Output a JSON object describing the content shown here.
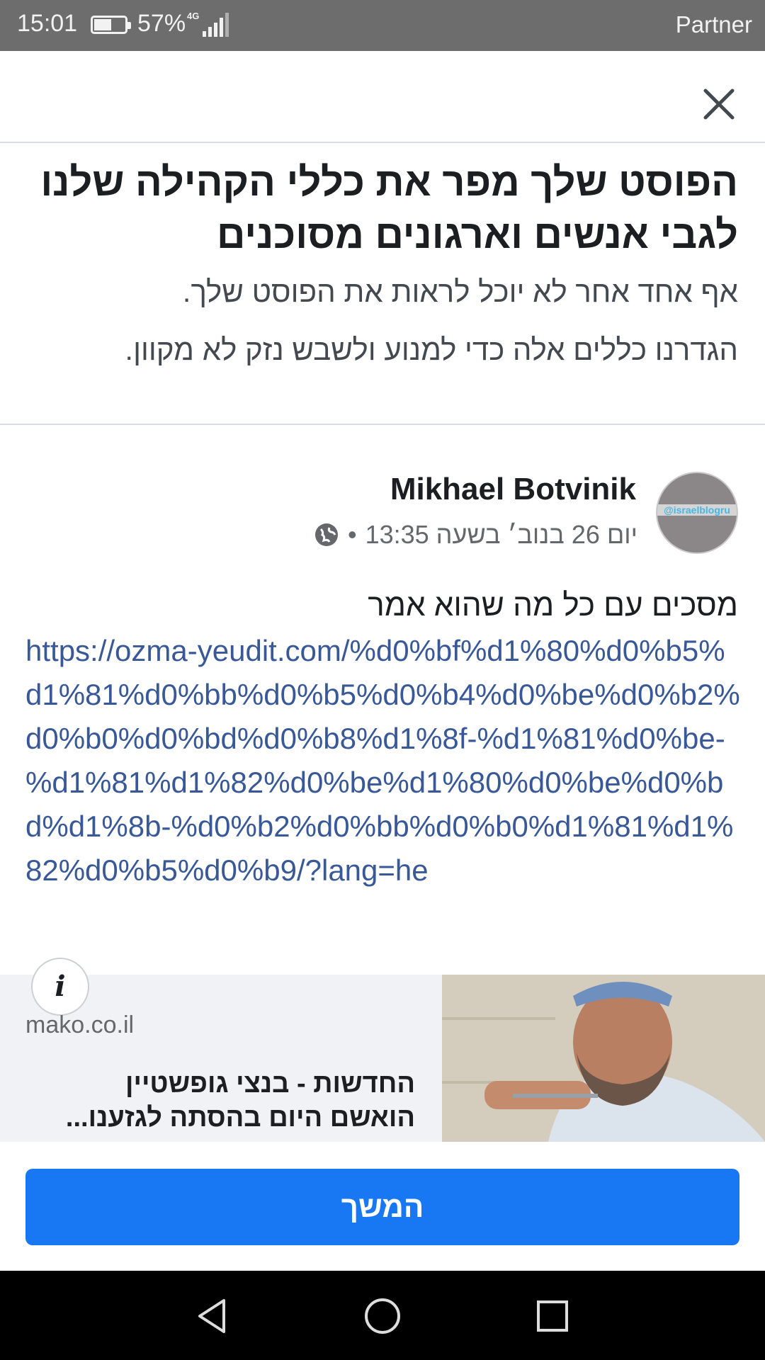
{
  "status_bar": {
    "time": "15:01",
    "battery_percent": "57%",
    "battery_level": 0.57,
    "network": "4G",
    "carrier": "Partner"
  },
  "top_bar": {
    "close_icon": "close-icon"
  },
  "header": {
    "title": "הפוסט שלך מפר את כללי הקהילה שלנו לגבי אנשים וארגונים מסוכנים",
    "description_1": "אף אחד אחר לא יוכל לראות את הפוסט שלך.",
    "description_2": "הגדרנו כללים אלה כדי למנוע ולשבש נזק לא מקוון."
  },
  "post": {
    "author": "Mikhael Botvinik",
    "avatar_text": "@israelblogru",
    "timestamp": "יום 26 בנוב׳ בשעה 13:35",
    "separator": "•",
    "privacy_icon": "globe-icon",
    "text": "מסכים עם כל מה שהוא אמר",
    "link": "https://ozma-yeudit.com/%d0%bf%d1%80%d0%b5%d1%81%d0%bb%d0%b5%d0%b4%d0%be%d0%b2%d0%b0%d0%bd%d0%b8%d1%8f-%d1%81%d0%be-%d1%81%d1%82%d0%be%d1%80%d0%be%d0%bd%d1%8b-%d0%b2%d0%bb%d0%b0%d1%81%d1%82%d0%b5%d0%b9/?lang=he"
  },
  "link_preview": {
    "info_icon": "info-icon",
    "domain": "mako.co.il",
    "title_line_1": "החדשות - בנצי גופשטיין",
    "title_line_2": "הואשם היום בהסתה לגזענו..."
  },
  "continue_button": {
    "label": "המשך",
    "color": "#1877f2"
  },
  "nav_bar": {
    "icons": [
      "back-icon",
      "home-icon",
      "recents-icon"
    ]
  }
}
